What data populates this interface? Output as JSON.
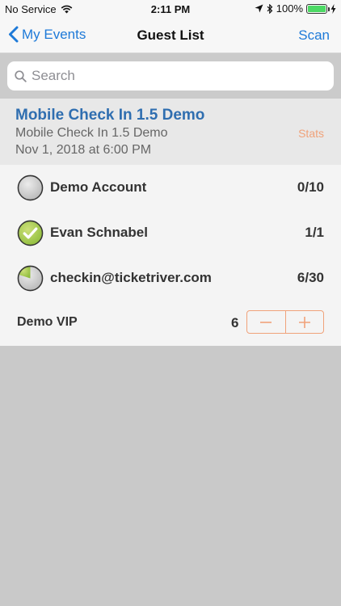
{
  "status_bar": {
    "carrier": "No Service",
    "time": "2:11 PM",
    "battery_percent": "100%",
    "battery_level": 1.0,
    "icons": [
      "wifi-icon",
      "location-icon",
      "bluetooth-icon",
      "battery-icon",
      "charging-icon"
    ]
  },
  "nav": {
    "back_label": "My Events",
    "title": "Guest List",
    "right_label": "Scan",
    "accent_color": "#1e7ad8"
  },
  "search": {
    "placeholder": "Search",
    "value": ""
  },
  "event": {
    "title": "Mobile Check In 1.5 Demo",
    "subtitle": "Mobile Check In 1.5 Demo",
    "date": "Nov 1, 2018 at 6:00 PM",
    "stats_label": "Stats",
    "title_color": "#2f6eb0",
    "stats_color": "#f0a27a"
  },
  "guests": [
    {
      "name": "Demo Account",
      "count": "0/10",
      "status": "none",
      "icon": "empty-circle-icon"
    },
    {
      "name": "Evan Schnabel",
      "count": "1/1",
      "status": "complete",
      "icon": "checkmark-circle-icon"
    },
    {
      "name": "checkin@ticketriver.com",
      "count": "6/30",
      "status": "partial",
      "icon": "partial-pie-icon",
      "fraction": 0.2
    }
  ],
  "ticket": {
    "name": "Demo VIP",
    "quantity": "6",
    "minus_icon": "minus-icon",
    "plus_icon": "plus-icon"
  }
}
